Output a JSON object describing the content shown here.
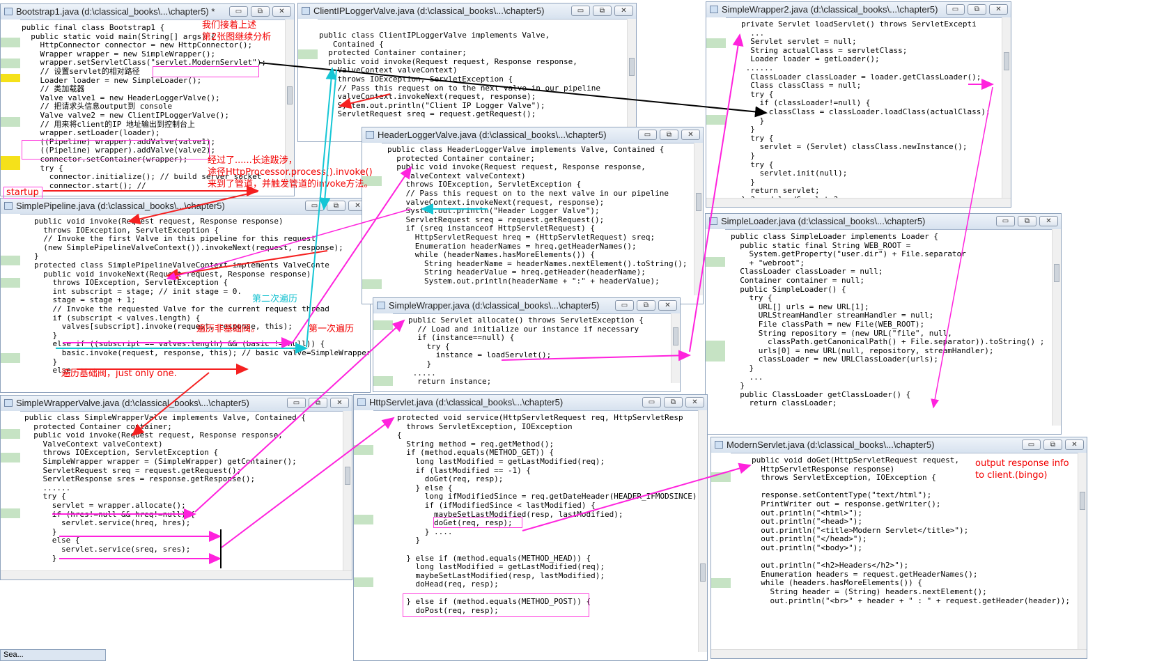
{
  "windows": {
    "bootstrap1": {
      "title": "Bootstrap1.java (d:\\classical_books\\...\\chapter5) *",
      "code": "public final class Bootstrap1 {\n  public static void main(String[] args) {\n    HttpConnector connector = new HttpConnector();\n    Wrapper wrapper = new SimpleWrapper();\n    wrapper.setServletClass(\"servlet.ModernServlet\");\n    // 设置servlet的相对路径\n    Loader loader = new SimpleLoader();\n    // 类加载器\n    Valve valve1 = new HeaderLoggerValve();\n    // 把请求头信息output到 console\n    Valve valve2 = new ClientIPLoggerValve();\n    // 用来将client的IP 地址输出到控制台上\n    wrapper.setLoader(loader);\n    ((Pipeline) wrapper).addValve(valve1);\n    ((Pipeline) wrapper).addValve(valve2);\n    connector.setContainer(wrapper);\n    try {\n      connector.initialize(); // build server socket\n      connector.start(); //"
    },
    "client_ip_logger_valve": {
      "title": "ClientIPLoggerValve.java (d:\\classical_books\\...\\chapter5)",
      "code": "public class ClientIPLoggerValve implements Valve,\n   Contained {\n  protected Container container;\n  public void invoke(Request request, Response response,\n    ValveContext valveContext)\n    throws IOException, ServletException {\n    // Pass this request on to the next valve in our pipeline\n    valveContext.invokeNext(request, response);\n    System.out.println(\"Client IP Logger Valve\");\n    ServletRequest sreq = request.getRequest();"
    },
    "simple_wrapper2": {
      "title": "SimpleWrapper2.java (d:\\classical_books\\...\\chapter5)",
      "code": "private Servlet loadServlet() throws ServletExcepti\n  ...\n  Servlet servlet = null;\n  String actualClass = servletClass;\n  Loader loader = getLoader();\n ......\n  ClassLoader classLoader = loader.getClassLoader();\n  Class classClass = null;\n  try {\n    if (classLoader!=null) {\n      classClass = classLoader.loadClass(actualClass);\n    }\n  }\n  try {\n    servlet = (Servlet) classClass.newInstance();\n  }\n  try {\n    servlet.init(null);\n  }\n  return servlet;\n} ? end loadServlet ?"
    },
    "header_logger_valve": {
      "title": "HeaderLoggerValve.java (d:\\classical_books\\...\\chapter5)",
      "code": "public class HeaderLoggerValve implements Valve, Contained {\n  protected Container container;\n  public void invoke(Request request, Response response,\n    ValveContext valveContext)\n    throws IOException, ServletException {\n    // Pass this request on to the next valve in our pipeline\n    valveContext.invokeNext(request, response);\n    System.out.println(\"Header Logger Valve\");\n    ServletRequest sreq = request.getRequest();\n    if (sreq instanceof HttpServletRequest) {\n      HttpServletRequest hreq = (HttpServletRequest) sreq;\n      Enumeration headerNames = hreq.getHeaderNames();\n      while (headerNames.hasMoreElements()) {\n        String headerName = headerNames.nextElement().toString();\n        String headerValue = hreq.getHeader(headerName);\n        System.out.println(headerName + \":\" + headerValue);"
    },
    "simple_pipeline": {
      "title": "SimplePipeline.java (d:\\classical_books\\...\\chapter5)",
      "code": "public void invoke(Request request, Response response)\n  throws IOException, ServletException {\n  // Invoke the first Valve in this pipeline for this request\n  (new SimplePipelineValveContext()).invokeNext(request, response);\n}\nprotected class SimplePipelineValveContext implements ValveConte\n  public void invokeNext(Request request, Response response)\n    throws IOException, ServletException {\n    int subscript = stage; // init stage = 0.\n    stage = stage + 1;\n    // Invoke the requested Valve for the current request thread\n    if (subscript < valves.length) {\n      valves[subscript].invoke(request, response, this);\n    }\n    else if ((subscript == valves.length) && (basic != null)) {\n      basic.invoke(request, response, this); // basic valve=SimpleWrapperValve\n    }\n    else"
    },
    "simple_loader": {
      "title": "SimpleLoader.java (d:\\classical_books\\...\\chapter5)",
      "code": "public class SimpleLoader implements Loader {\n  public static final String WEB_ROOT =\n    System.getProperty(\"user.dir\") + File.separator\n    + \"webroot\";\n  ClassLoader classLoader = null;\n  Container container = null;\n  public SimpleLoader() {\n    try {\n      URL[] urls = new URL[1];\n      URLStreamHandler streamHandler = null;\n      File classPath = new File(WEB_ROOT);\n      String repository = (new URL(\"file\", null,\n        classPath.getCanonicalPath() + File.separator)).toString() ;\n      urls[0] = new URL(null, repository, streamHandler);\n      classLoader = new URLClassLoader(urls);\n    }\n    ...\n  }\n  public ClassLoader getClassLoader() {\n    return classLoader;"
    },
    "simple_wrapper": {
      "title": "SimpleWrapper.java (d:\\classical_books\\...\\chapter5)",
      "code": "public Servlet allocate() throws ServletException {\n  // Load and initialize our instance if necessary\n  if (instance==null) {\n    try {\n      instance = loadServlet();\n    }\n .....\n  return instance;"
    },
    "simple_wrapper_valve": {
      "title": "SimpleWrapperValve.java (d:\\classical_books\\...\\chapter5)",
      "code": "public class SimpleWrapperValve implements Valve, Contained {\n  protected Container container;\n  public void invoke(Request request, Response response,\n    ValveContext valveContext)\n    throws IOException, ServletException {\n    SimpleWrapper wrapper = (SimpleWrapper) getContainer();\n    ServletRequest sreq = request.getRequest();\n    ServletResponse sres = response.getResponse();\n    ......\n    try {\n      servlet = wrapper.allocate();\n      if (hres!=null && hreq!=null) {\n        servlet.service(hreq, hres);\n      }\n      else {\n        servlet.service(sreq, sres);\n      }"
    },
    "http_servlet": {
      "title": "HttpServlet.java (d:\\classical_books\\...\\chapter5)",
      "code": "protected void service(HttpServletRequest req, HttpServletResp\n  throws ServletException, IOException\n{\n  String method = req.getMethod();\n  if (method.equals(METHOD_GET)) {\n    long lastModified = getLastModified(req);\n    if (lastModified == -1) {\n      doGet(req, resp);\n    } else {\n      long ifModifiedSince = req.getDateHeader(HEADER_IFMODSINCE);\n      if (ifModifiedSince < lastModified) {\n        maybeSetLastModified(resp, lastModified);\n        doGet(req, resp);\n      } ....\n    }\n\n  } else if (method.equals(METHOD_HEAD)) {\n    long lastModified = getLastModified(req);\n    maybeSetLastModified(resp, lastModified);\n    doHead(req, resp);\n\n  } else if (method.equals(METHOD_POST)) {\n    doPost(req, resp);"
    },
    "modern_servlet": {
      "title": "ModernServlet.java (d:\\classical_books\\...\\chapter5)",
      "code": "public void doGet(HttpServletRequest request,\n  HttpServletResponse response)\n  throws ServletException, IOException {\n\n  response.setContentType(\"text/html\");\n  PrintWriter out = response.getWriter();\n  out.println(\"<html>\");\n  out.println(\"<head>\");\n  out.println(\"<title>Modern Servlet</title>\");\n  out.println(\"</head>\");\n  out.println(\"<body>\");\n\n  out.println(\"<h2>Headers</h2>\");\n  Enumeration headers = request.getHeaderNames();\n  while (headers.hasMoreElements()) {\n    String header = (String) headers.nextElement();\n    out.println(\"<br>\" + header + \" : \" + request.getHeader(header));"
    }
  },
  "annotations": {
    "note_top": "我们接着上述\n第2张图继续分析",
    "note_process": "经过了......长途跋涉，\n途径HttpProcessor.process().invoke()\n来到了管道，并触发管道的invoke方法。",
    "second_traverse": "第二次遍历",
    "first_traverse": "第一次遍历",
    "traverse_non_basic": "遍历非基础阀。",
    "traverse_basic": "遍历基础阀，just only one.",
    "output_response": "output response info\nto client.(bingo)",
    "startup_label": "startup"
  },
  "taskbar": {
    "label": "Sea..."
  },
  "window_buttons": {
    "min": "▭",
    "max": "⧉",
    "close": "✕"
  },
  "colors": {
    "magenta_arrow": "#ff22dd",
    "red_arrow": "#f52020",
    "cyan_arrow": "#15c6d5",
    "black_arrow": "#000000",
    "gutter_marker": "#c6e3c4",
    "breakpoint_marker": "#f5e11a"
  }
}
